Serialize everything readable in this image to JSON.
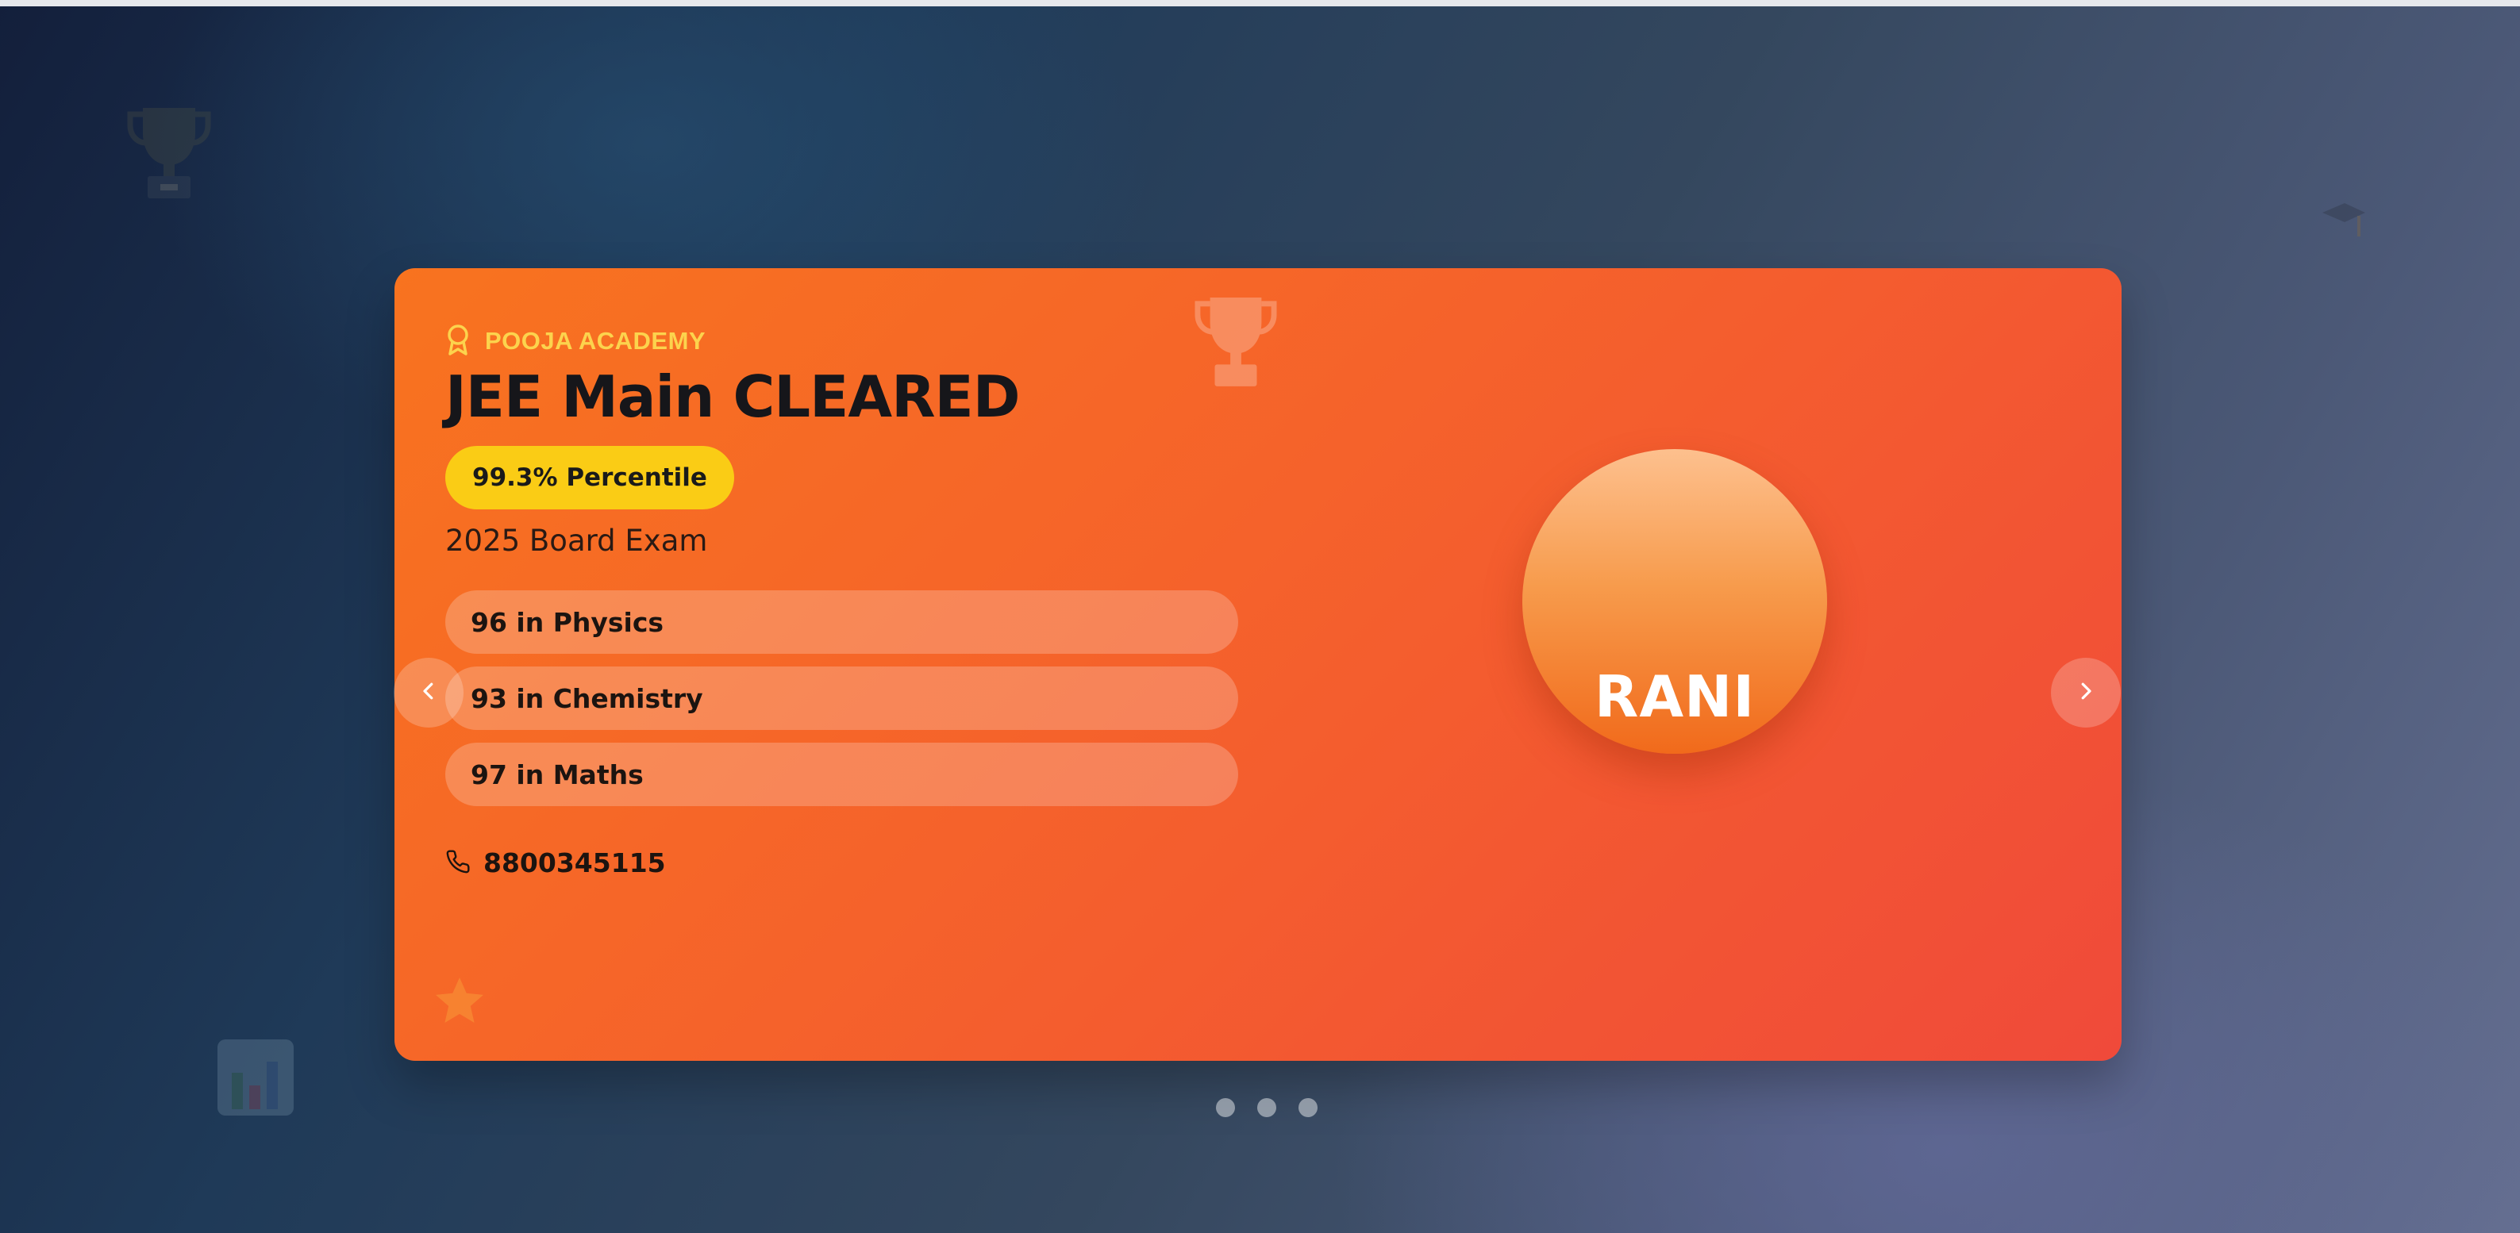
{
  "card": {
    "academy": "POOJA ACADEMY",
    "academy_icon": "award-ribbon-icon",
    "title": "JEE Main CLEARED",
    "badge": "99.3% Percentile",
    "exam": "2025 Board Exam",
    "subjects": [
      {
        "label": "96 in Physics"
      },
      {
        "label": "93 in Chemistry"
      },
      {
        "label": "97 in Maths"
      }
    ],
    "phone_icon": "phone-icon",
    "phone": "8800345115",
    "student_name": "RANI"
  },
  "carousel": {
    "prev_icon": "chevron-left-icon",
    "next_icon": "chevron-right-icon",
    "slide_count": 3
  },
  "colors": {
    "card_gradient_start": "#f8731f",
    "card_gradient_end": "#f04a3a",
    "badge": "#facc15",
    "academy_text": "#fcd34d",
    "text_dark": "#16161a"
  },
  "decorations": [
    "trophy-icon",
    "graduation-cap-icon",
    "bar-chart-icon",
    "star-icon"
  ]
}
